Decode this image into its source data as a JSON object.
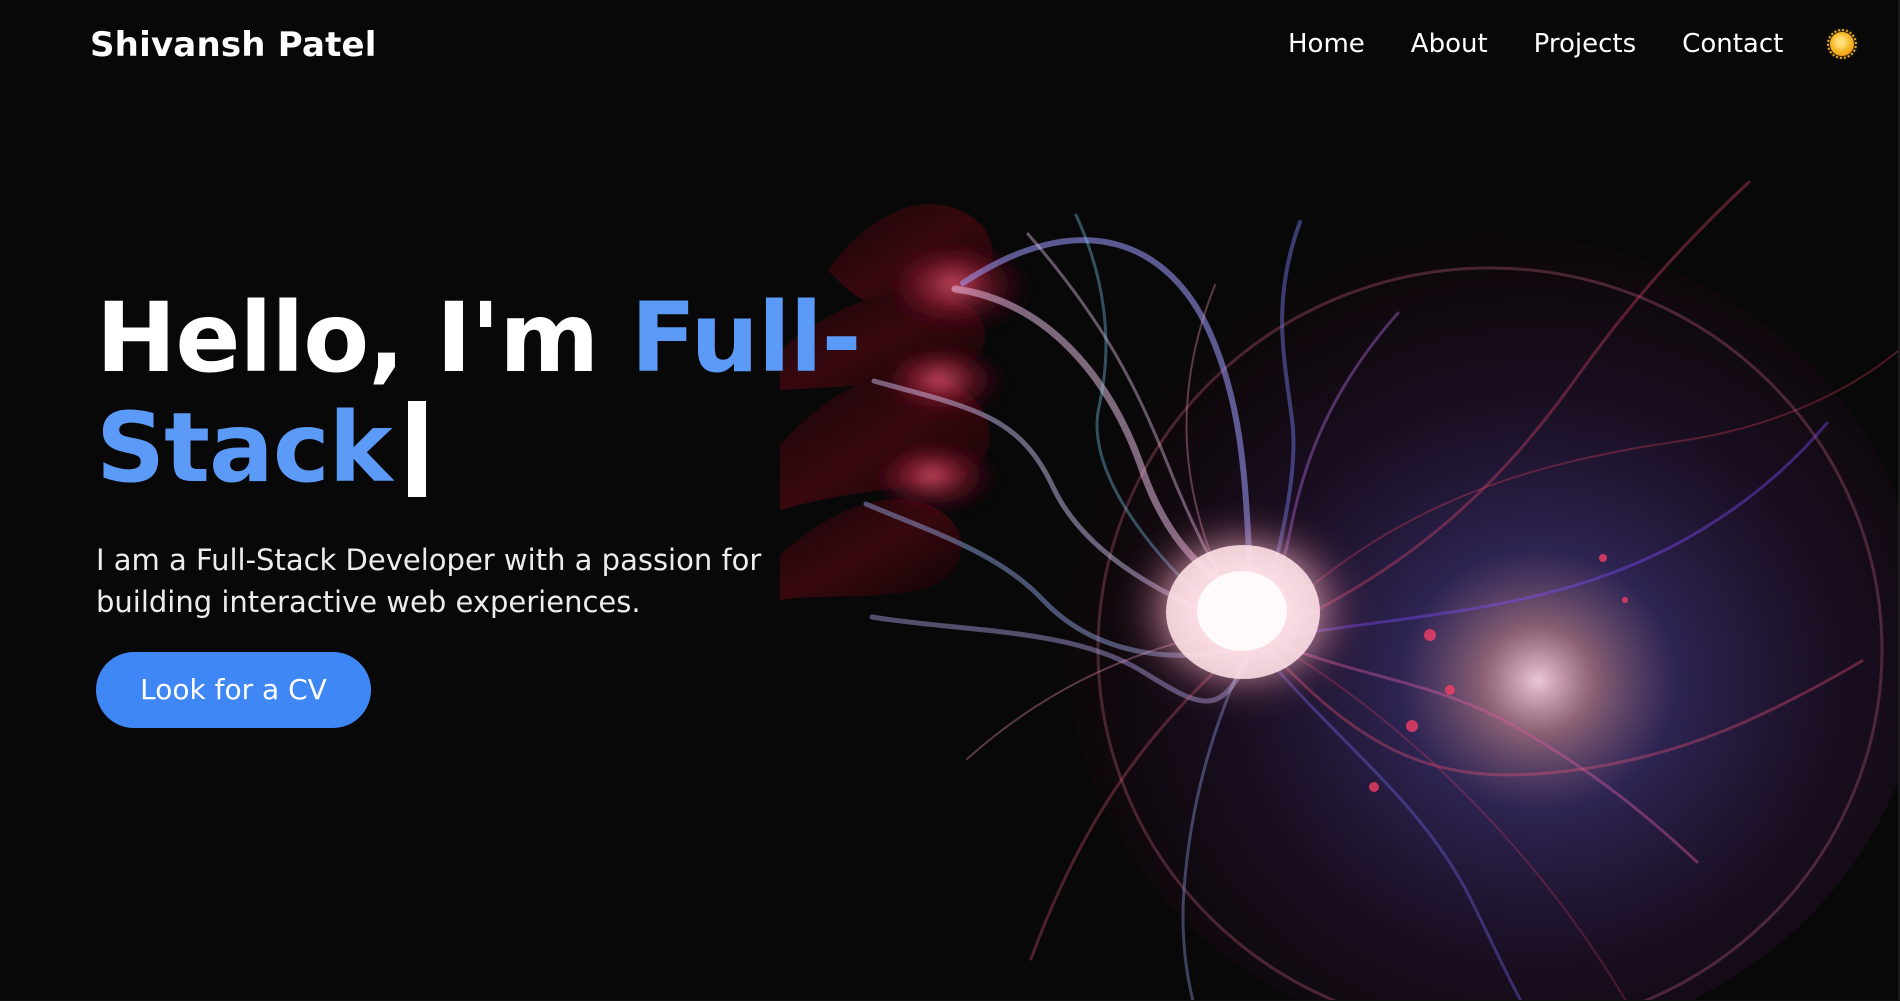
{
  "brand": {
    "name": "Shivansh Patel"
  },
  "navigation": {
    "links": [
      {
        "label": "Home"
      },
      {
        "label": "About"
      },
      {
        "label": "Projects"
      },
      {
        "label": "Contact"
      }
    ],
    "theme_toggle_icon": "sun-icon"
  },
  "hero": {
    "heading_prefix": "Hello, I'm ",
    "heading_accent_line1": "Full-",
    "heading_accent_line2": "Stack",
    "cursor_glyph": "|",
    "description": "I am a Full-Stack Developer with a passion for building interactive web experiences.",
    "cta_label": "Look for a CV"
  },
  "theme": {
    "background": "#080809",
    "text": "#ffffff",
    "accent": "#5c9af7",
    "button": "#3f87f5",
    "sun": "#f7bc2c"
  },
  "background_art": {
    "icon": "plasma-globe-image"
  }
}
